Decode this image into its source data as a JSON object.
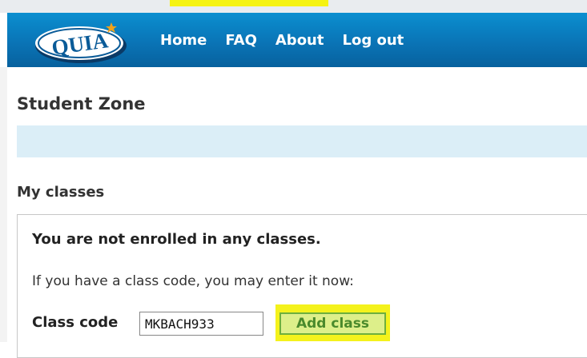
{
  "header": {
    "logo_text": "QUIA",
    "nav": [
      {
        "label": "Home"
      },
      {
        "label": "FAQ"
      },
      {
        "label": "About"
      },
      {
        "label": "Log out"
      }
    ],
    "colors": {
      "bar_top": "#0b8fd0",
      "bar_bottom": "#07619e",
      "nav_text": "#ffffff"
    }
  },
  "page": {
    "title": "Student Zone",
    "info_bar_color": "#dbeef7"
  },
  "classes": {
    "section_title": "My classes",
    "status_message": "You are not enrolled in any classes.",
    "instructions": "If you have a class code, you may enter it now:",
    "code_label": "Class code",
    "code_value": "MKBACH933",
    "add_button_label": "Add class",
    "highlight_color": "#f4f21c"
  }
}
